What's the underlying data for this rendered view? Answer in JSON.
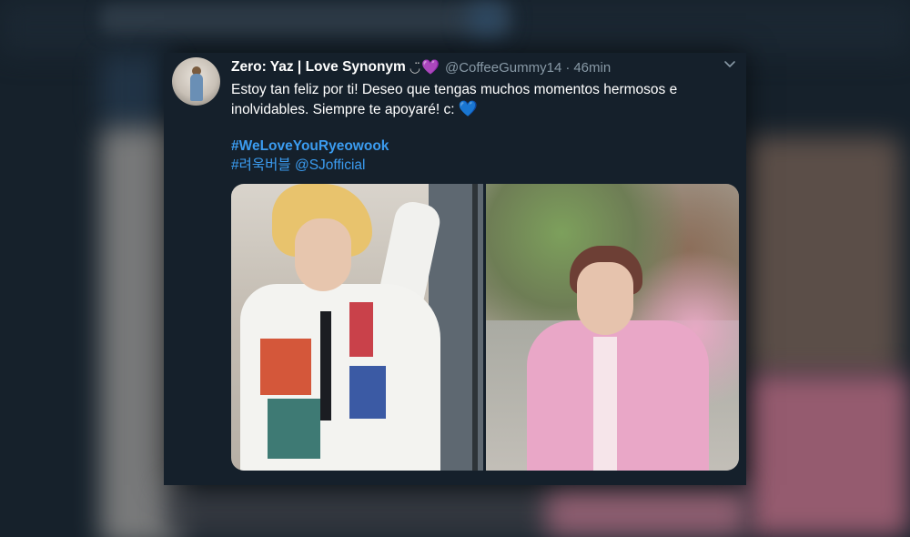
{
  "tweet": {
    "display_name": "Zero: Yaz | Love Synonym",
    "name_emoji": "◡̈",
    "name_heart": "💜",
    "handle": "@CoffeeGummy14",
    "separator": "·",
    "time": "46min",
    "text": "Estoy tan feliz por ti! Deseo que tengas muchos momentos hermosos e inolvidables. Siempre te apoyaré! c:",
    "text_heart": "💙",
    "hashtag_main": "#WeLoveYouRyeowook",
    "hashtag_kr": "#려욱버블",
    "mention": "@SJofficial",
    "menu_icon": "chevron-down-icon",
    "media_count": 2
  },
  "colors": {
    "background": "#15202b",
    "link": "#3b9cf0",
    "muted": "#8899a6",
    "text": "#ffffff"
  }
}
